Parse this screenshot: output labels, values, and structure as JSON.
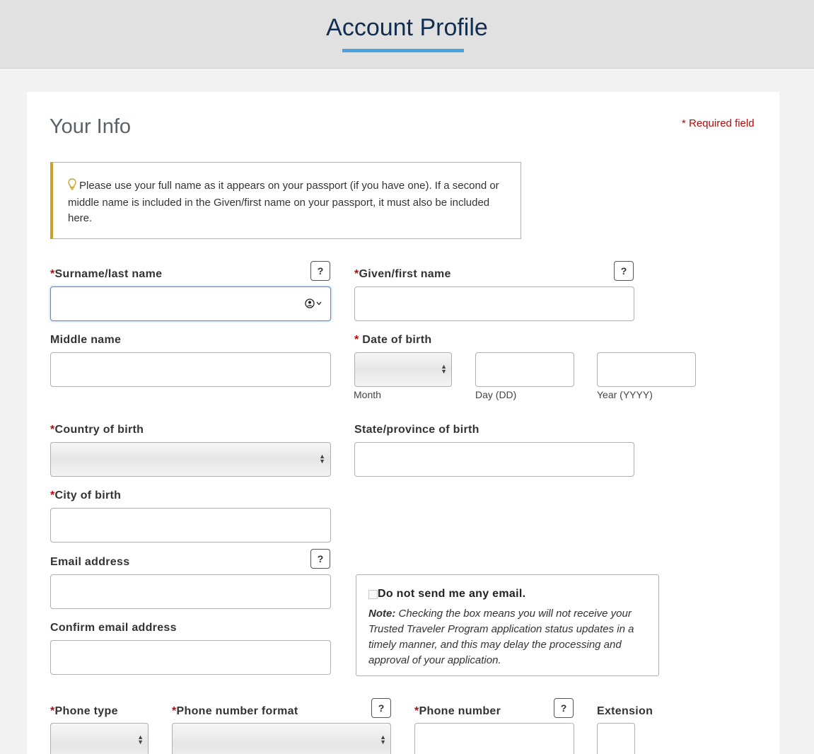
{
  "header": {
    "title": "Account Profile"
  },
  "section": {
    "title": "Your Info",
    "required_note": "* Required field"
  },
  "notice": {
    "text": "Please use your full name as it appears on your passport (if you have one). If a second or middle name is included in the Given/first name on your passport, it must also be included here."
  },
  "required_marker": "*",
  "help_label": "?",
  "fields": {
    "surname": {
      "label": "Surname/last name",
      "value": ""
    },
    "given_name": {
      "label": "Given/first name",
      "value": ""
    },
    "middle_name": {
      "label": "Middle name",
      "value": ""
    },
    "dob": {
      "label": "Date of birth",
      "month_label": "Month",
      "day_label": "Day (DD)",
      "year_label": "Year (YYYY)"
    },
    "country_of_birth": {
      "label": "Country of birth",
      "value": ""
    },
    "state_of_birth": {
      "label": "State/province of birth",
      "value": ""
    },
    "city_of_birth": {
      "label": "City of birth",
      "value": ""
    },
    "email": {
      "label": "Email address",
      "value": ""
    },
    "confirm_email": {
      "label": "Confirm email address",
      "value": ""
    },
    "phone_type": {
      "label": "Phone type"
    },
    "phone_format": {
      "label": "Phone number format"
    },
    "phone_number": {
      "label": "Phone number"
    },
    "extension": {
      "label": "Extension"
    }
  },
  "email_opt_out": {
    "checkbox_label": "Do not send me any email.",
    "checked": false,
    "note_prefix": "Note:",
    "note_text": "Checking the box means you will not receive your Trusted Traveler Program application status updates in a timely manner, and this may delay the processing and approval of your application."
  },
  "colors": {
    "title": "#112e51",
    "accent": "#4aa3df",
    "required": "#b50909",
    "notice_bar": "#c9a227"
  },
  "icons": {
    "notice": "lightbulb-icon",
    "autofill": "contact-card-icon",
    "select": "updown-arrows-icon"
  }
}
